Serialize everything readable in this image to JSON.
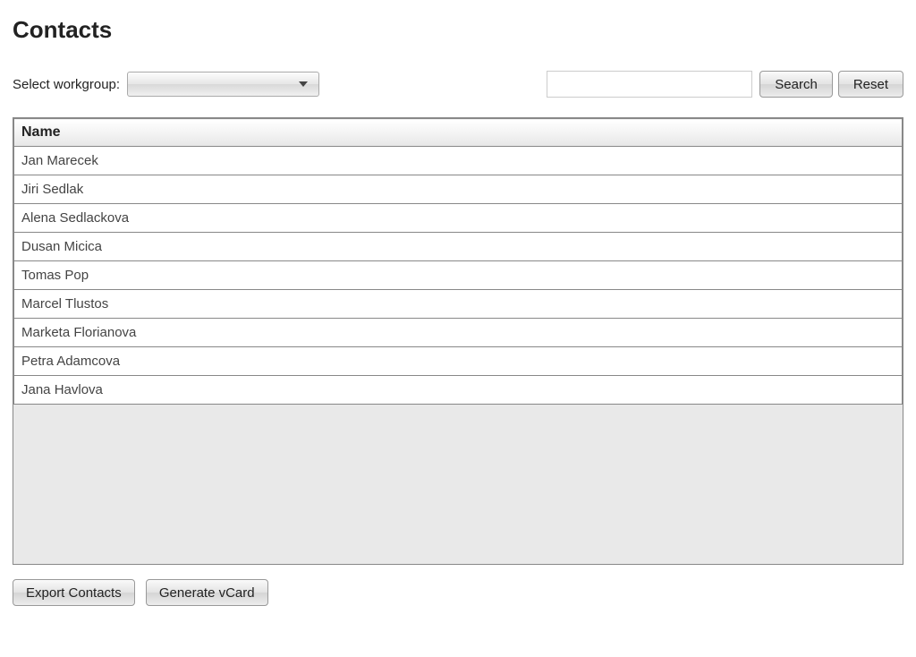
{
  "page": {
    "title": "Contacts"
  },
  "controls": {
    "select_label": "Select workgroup:",
    "workgroup_selected": "",
    "search_value": "",
    "search_button": "Search",
    "reset_button": "Reset"
  },
  "table": {
    "header": "Name",
    "rows": [
      {
        "name": "Jan Marecek"
      },
      {
        "name": "Jiri Sedlak"
      },
      {
        "name": "Alena Sedlackova"
      },
      {
        "name": "Dusan Micica"
      },
      {
        "name": "Tomas Pop"
      },
      {
        "name": "Marcel Tlustos"
      },
      {
        "name": "Marketa Florianova"
      },
      {
        "name": "Petra Adamcova"
      },
      {
        "name": "Jana Havlova"
      }
    ]
  },
  "buttons": {
    "export": "Export Contacts",
    "vcard": "Generate vCard"
  }
}
